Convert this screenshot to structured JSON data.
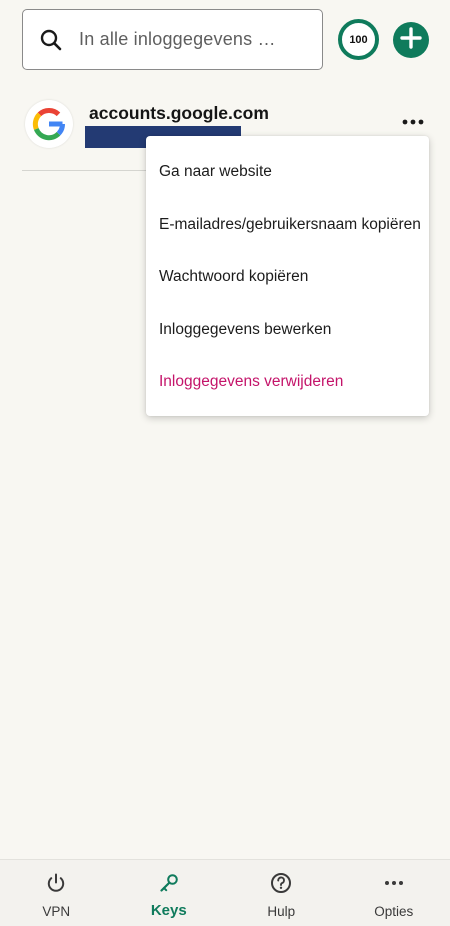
{
  "search": {
    "placeholder": "In alle inloggegevens …",
    "icon": "search-icon"
  },
  "header": {
    "password_score": "100",
    "add_icon": "plus-icon"
  },
  "entries": [
    {
      "domain": "accounts.google.com",
      "logo": "google-logo-icon",
      "more_icon": "more-horizontal-icon"
    }
  ],
  "menu": {
    "items": [
      {
        "label": "Ga naar website"
      },
      {
        "label": "E-mailadres/gebruikersnaam kopiëren"
      },
      {
        "label": "Wachtwoord kopiëren"
      },
      {
        "label": "Inloggegevens bewerken"
      },
      {
        "label": "Inloggegevens verwijderen"
      }
    ]
  },
  "nav": {
    "tabs": [
      {
        "label": "VPN",
        "icon": "power-icon"
      },
      {
        "label": "Keys",
        "icon": "key-icon",
        "active": true
      },
      {
        "label": "Hulp",
        "icon": "help-circle-icon"
      },
      {
        "label": "Opties",
        "icon": "more-horizontal-icon"
      }
    ]
  },
  "colors": {
    "accent": "#0f7b5c",
    "danger": "#c4146a",
    "background": "#f8f7f2",
    "redaction": "#233a73"
  }
}
